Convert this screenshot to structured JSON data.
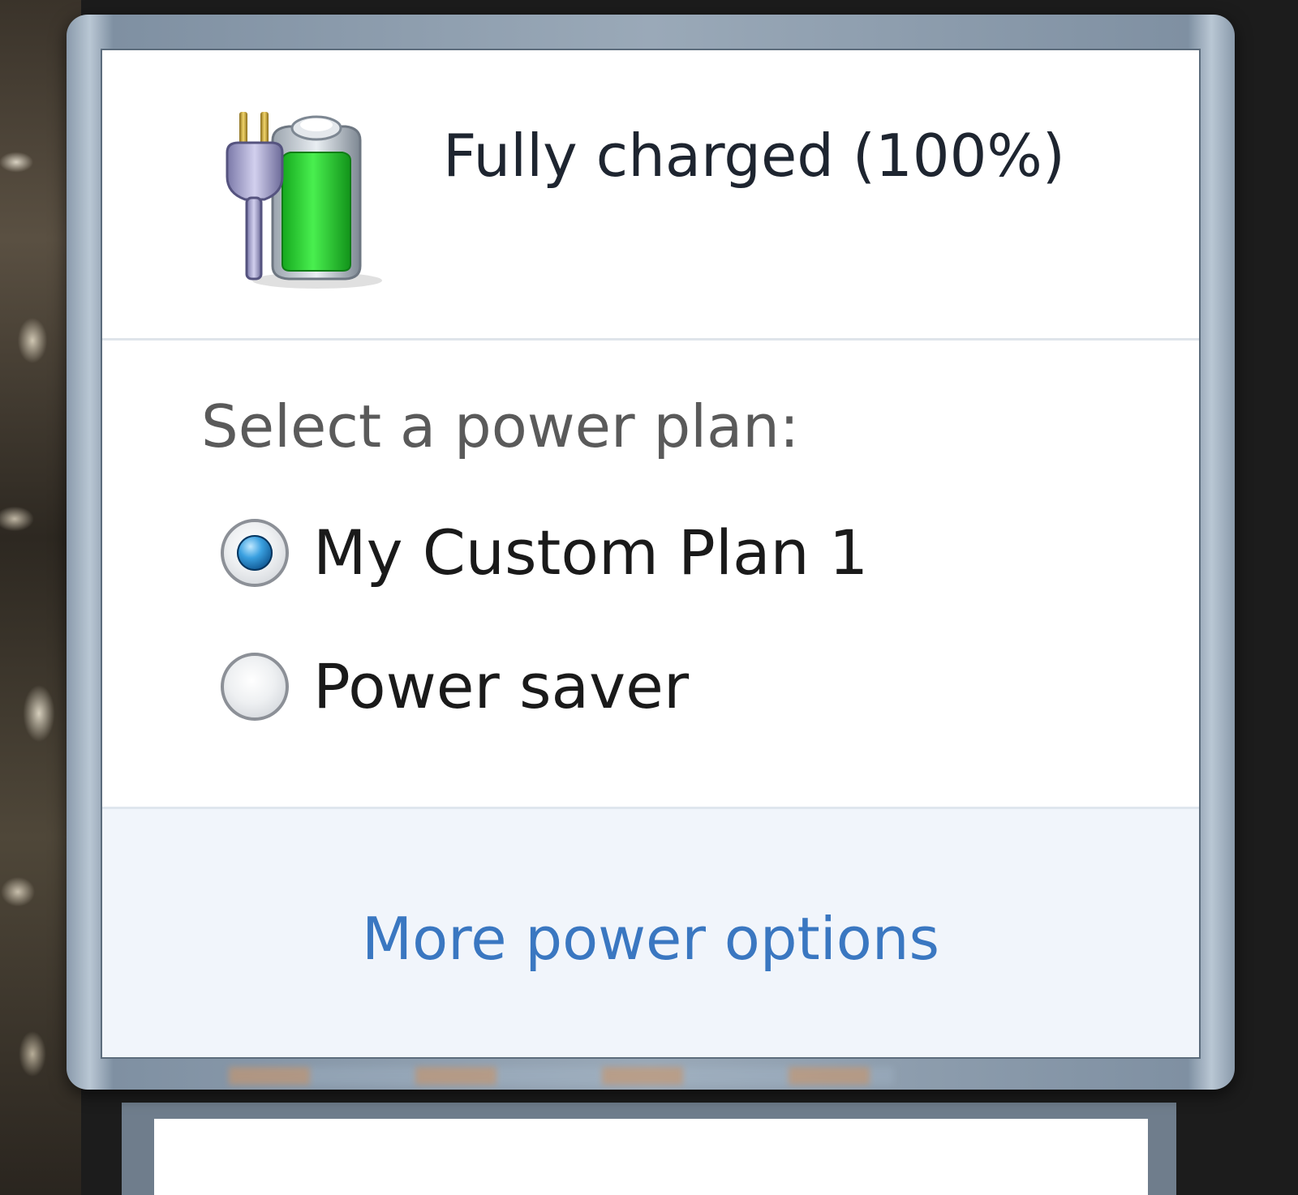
{
  "battery": {
    "status_text": "Fully charged (100%)",
    "icon": "battery-plugged-in-icon",
    "charge_fraction": 1.0
  },
  "power_plan": {
    "heading": "Select a power plan:",
    "options": [
      {
        "label": "My Custom Plan 1",
        "selected": true
      },
      {
        "label": "Power saver",
        "selected": false
      }
    ]
  },
  "footer": {
    "more_options_label": "More power options"
  },
  "colors": {
    "link": "#3a77c1",
    "battery_fill": "#2fd13a",
    "radio_selected": "#1a6fb5"
  }
}
